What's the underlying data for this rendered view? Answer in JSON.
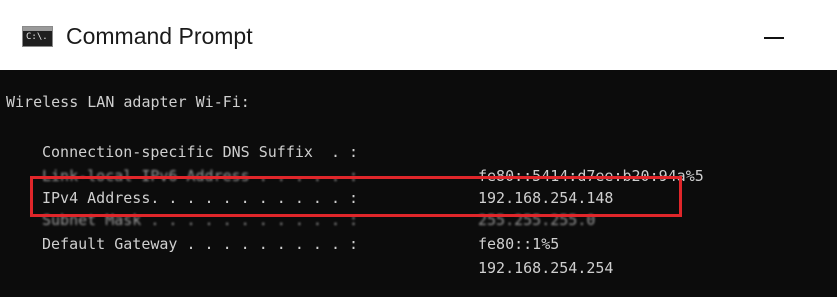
{
  "window": {
    "title": "Command Prompt",
    "icon": "cmd-icon",
    "icon_text": "C:\\."
  },
  "console": {
    "adapter_header": "Wireless LAN adapter Wi-Fi:",
    "lines": [
      {
        "label": "Connection-specific DNS Suffix  . :",
        "value": ""
      },
      {
        "label": "Link-local IPv6 Address . . . . . :",
        "value": "fe80::5414:d7ee:b20:94a%5"
      },
      {
        "label": "IPv4 Address. . . . . . . . . . . :",
        "value": "192.168.254.148"
      },
      {
        "label": "Subnet Mask . . . . . . . . . . . :",
        "value": "255.255.255.0"
      },
      {
        "label": "Default Gateway . . . . . . . . . :",
        "value": "fe80::1%5"
      },
      {
        "label": "",
        "value": "192.168.254.254"
      }
    ]
  },
  "colors": {
    "console_bg": "#0c0c0c",
    "console_text": "#cfcfcf",
    "highlight": "#e0262a"
  }
}
